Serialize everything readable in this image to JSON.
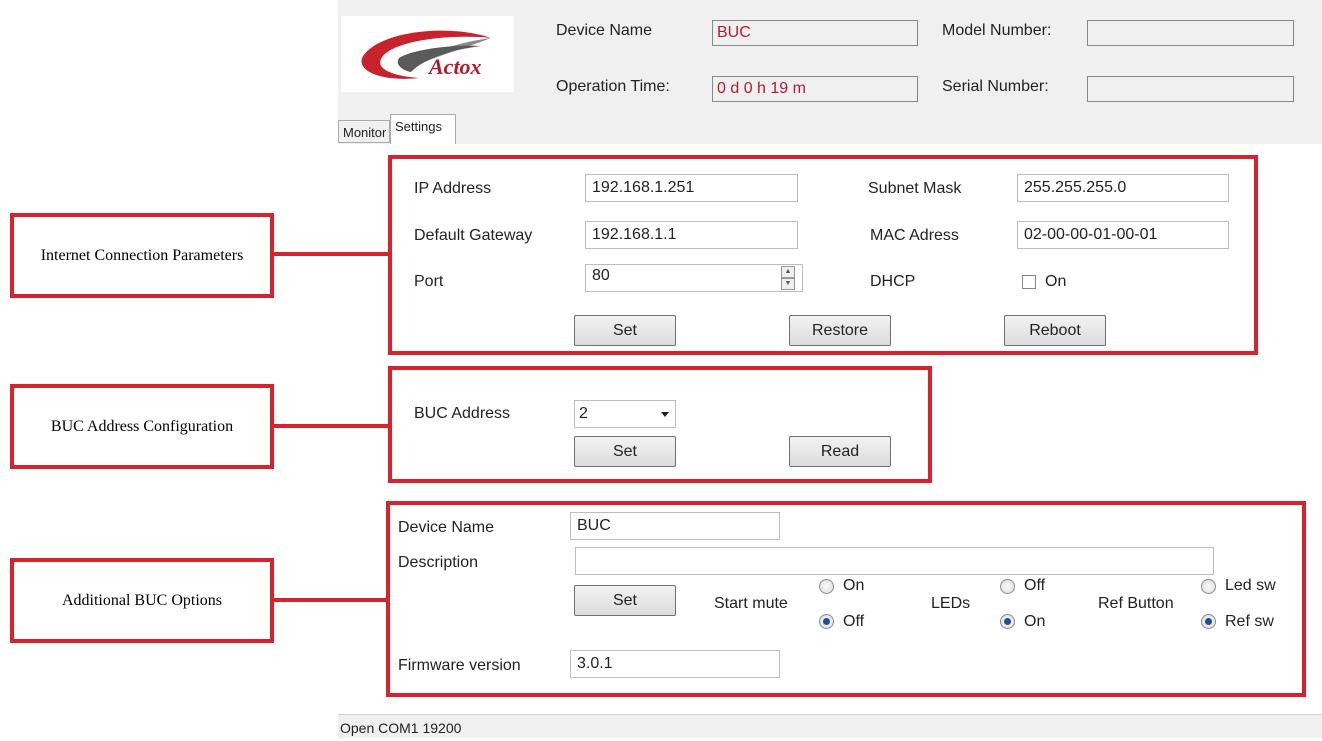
{
  "header": {
    "device_name_label": "Device Name",
    "device_name_value": "BUC",
    "operation_time_label": "Operation Time:",
    "operation_time_value": "0 d 0 h 19 m",
    "model_number_label": "Model Number:",
    "model_number_value": "",
    "serial_number_label": "Serial Number:",
    "serial_number_value": "",
    "logo_text": "Actox"
  },
  "tabs": [
    {
      "label": "Monitor",
      "active": false
    },
    {
      "label": "Settings",
      "active": true
    }
  ],
  "network": {
    "callout": "Internet Connection Parameters",
    "ip_label": "IP Address",
    "ip_value": "192.168.1.251",
    "subnet_label": "Subnet Mask",
    "subnet_value": "255.255.255.0",
    "gateway_label": "Default Gateway",
    "gateway_value": "192.168.1.1",
    "mac_label": "MAC Adress",
    "mac_value": "02-00-00-01-00-01",
    "port_label": "Port",
    "port_value": "80",
    "dhcp_label": "DHCP",
    "dhcp_option": "On",
    "dhcp_checked": false,
    "set_button": "Set",
    "restore_button": "Restore",
    "reboot_button": "Reboot"
  },
  "buc_address": {
    "callout": "BUC Address Configuration",
    "label": "BUC Address",
    "selected": "2",
    "set_button": "Set",
    "read_button": "Read"
  },
  "options": {
    "callout": "Additional BUC Options",
    "device_name_label": "Device Name",
    "device_name_value": "BUC",
    "description_label": "Description",
    "description_value": "",
    "set_button": "Set",
    "start_mute_label": "Start mute",
    "start_mute_on": "On",
    "start_mute_off": "Off",
    "start_mute_selected": "Off",
    "leds_label": "LEDs",
    "leds_off": "Off",
    "leds_on": "On",
    "leds_selected": "On",
    "ref_button_label": "Ref Button",
    "ref_led_sw": "Led sw",
    "ref_ref_sw": "Ref sw",
    "ref_selected": "Ref sw",
    "firmware_label": "Firmware version",
    "firmware_value": "3.0.1"
  },
  "status_bar": {
    "text": "Open COM1  19200"
  },
  "colors": {
    "annotation_red": "#d8232f",
    "value_red": "#b01c2e",
    "panel_gray": "#f0f0f0",
    "radio_selected": "#1a4f9a"
  }
}
